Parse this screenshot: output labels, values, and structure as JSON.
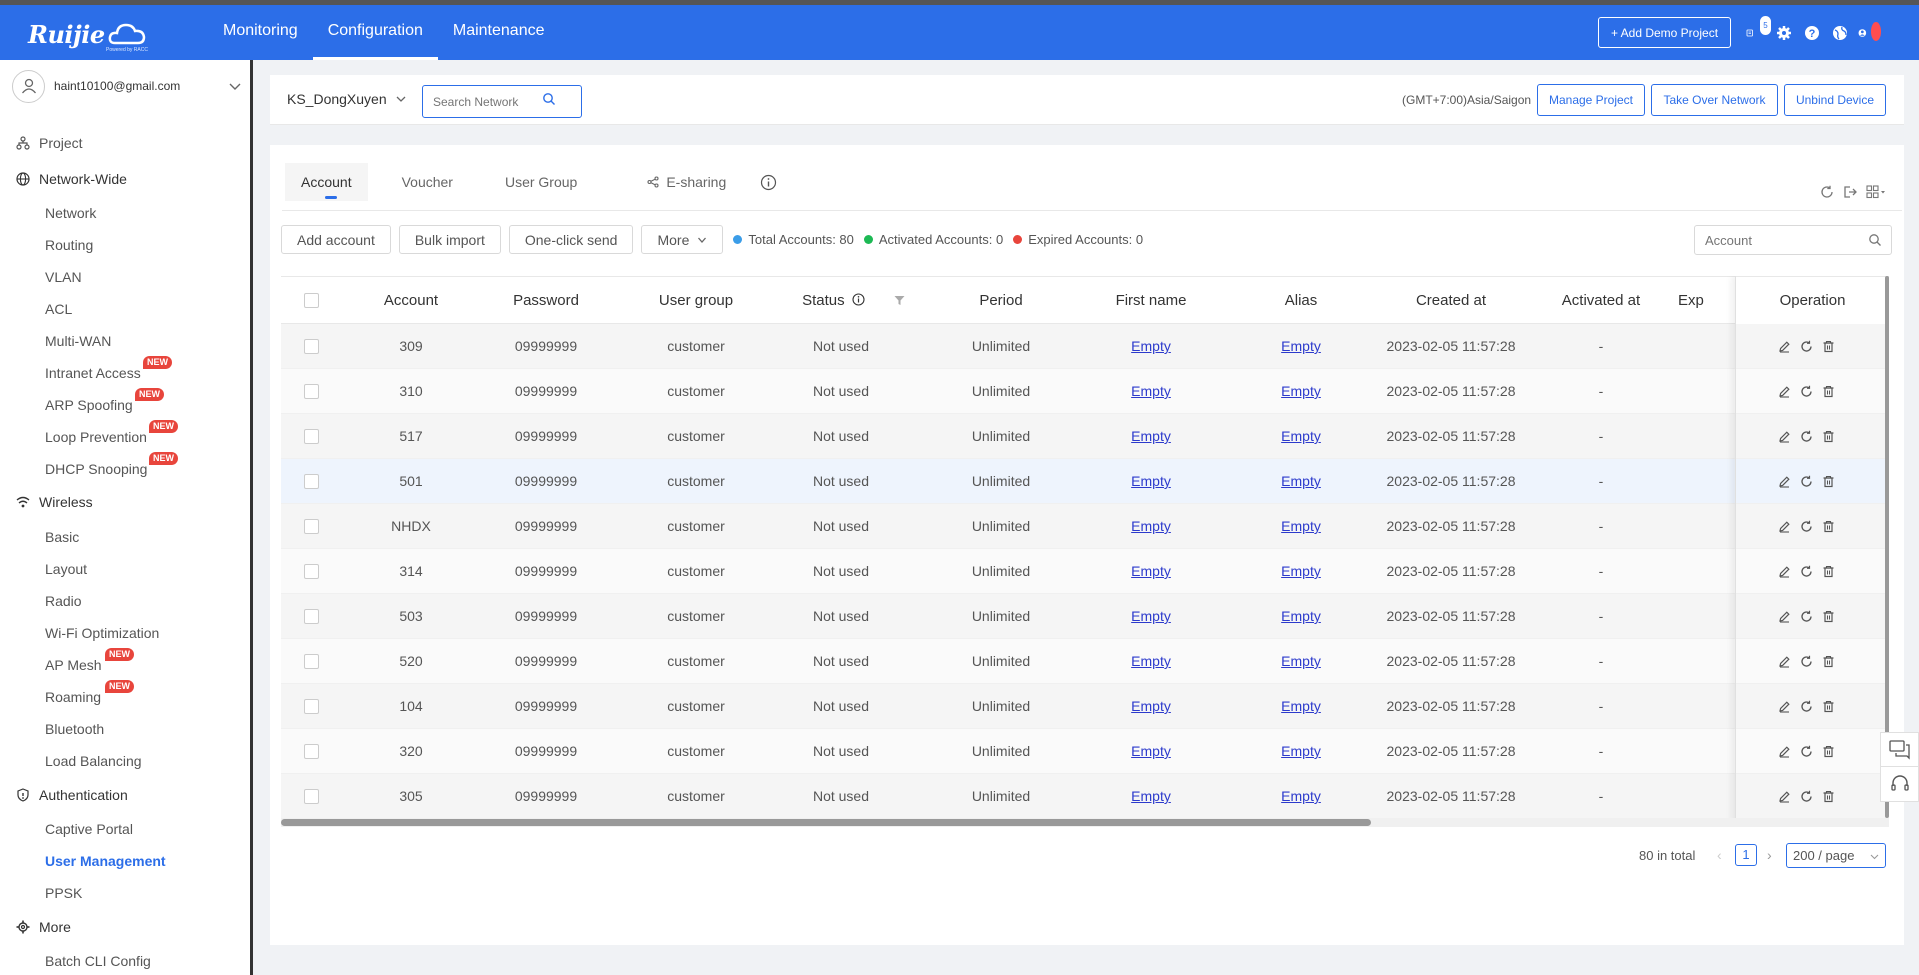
{
  "brand": {
    "logo_text": "Ruijie",
    "logo_sub": "Powered by RACC"
  },
  "topnav": [
    {
      "label": "Monitoring"
    },
    {
      "label": "Configuration"
    },
    {
      "label": "Maintenance"
    }
  ],
  "topbar": {
    "add_demo_label": "+ Add Demo Project",
    "message_count": "5"
  },
  "user": {
    "email": "haint10100@gmail.com"
  },
  "sidebar": {
    "project": "Project",
    "network_wide": "Network-Wide",
    "network_items": [
      "Network",
      "Routing",
      "VLAN",
      "ACL",
      "Multi-WAN",
      "Intranet Access",
      "ARP Spoofing",
      "Loop Prevention",
      "DHCP Snooping"
    ],
    "wireless": "Wireless",
    "wireless_items": [
      "Basic",
      "Layout",
      "Radio",
      "Wi-Fi Optimization",
      "AP Mesh",
      "Roaming",
      "Bluetooth",
      "Load Balancing"
    ],
    "authentication": "Authentication",
    "auth_items": [
      "Captive Portal",
      "User Management",
      "PPSK"
    ],
    "more": "More",
    "more_items": [
      "Batch CLI Config"
    ],
    "new_badge": "NEW"
  },
  "header": {
    "project_name": "KS_DongXuyen",
    "search_placeholder": "Search Network",
    "timezone": "(GMT+7:00)Asia/Saigon",
    "manage_project": "Manage Project",
    "take_over": "Take Over Network",
    "unbind": "Unbind Device"
  },
  "tabs": [
    "Account",
    "Voucher",
    "User Group",
    "E-sharing"
  ],
  "toolbar": {
    "add_account": "Add account",
    "bulk_import": "Bulk import",
    "one_click_send": "One-click send",
    "more": "More",
    "total_accounts": "Total Accounts: 80",
    "activated_accounts": "Activated Accounts: 0",
    "expired_accounts": "Expired Accounts: 0",
    "account_search_placeholder": "Account"
  },
  "colors": {
    "accent": "#2c6ee8",
    "total_dot": "#3b9de8",
    "activated_dot": "#1db954",
    "expired_dot": "#e8453c"
  },
  "table": {
    "columns": [
      "Account",
      "Password",
      "User group",
      "Status",
      "Period",
      "First name",
      "Alias",
      "Created at",
      "Activated at",
      "Exp",
      "Operation"
    ],
    "rows": [
      {
        "account": "309",
        "password": "09999999",
        "group": "customer",
        "status": "Not used",
        "period": "Unlimited",
        "first_name": "Empty",
        "alias": "Empty",
        "created": "2023-02-05 11:57:28",
        "activated": "-"
      },
      {
        "account": "310",
        "password": "09999999",
        "group": "customer",
        "status": "Not used",
        "period": "Unlimited",
        "first_name": "Empty",
        "alias": "Empty",
        "created": "2023-02-05 11:57:28",
        "activated": "-"
      },
      {
        "account": "517",
        "password": "09999999",
        "group": "customer",
        "status": "Not used",
        "period": "Unlimited",
        "first_name": "Empty",
        "alias": "Empty",
        "created": "2023-02-05 11:57:28",
        "activated": "-"
      },
      {
        "account": "501",
        "password": "09999999",
        "group": "customer",
        "status": "Not used",
        "period": "Unlimited",
        "first_name": "Empty",
        "alias": "Empty",
        "created": "2023-02-05 11:57:28",
        "activated": "-"
      },
      {
        "account": "NHDX",
        "password": "09999999",
        "group": "customer",
        "status": "Not used",
        "period": "Unlimited",
        "first_name": "Empty",
        "alias": "Empty",
        "created": "2023-02-05 11:57:28",
        "activated": "-"
      },
      {
        "account": "314",
        "password": "09999999",
        "group": "customer",
        "status": "Not used",
        "period": "Unlimited",
        "first_name": "Empty",
        "alias": "Empty",
        "created": "2023-02-05 11:57:28",
        "activated": "-"
      },
      {
        "account": "503",
        "password": "09999999",
        "group": "customer",
        "status": "Not used",
        "period": "Unlimited",
        "first_name": "Empty",
        "alias": "Empty",
        "created": "2023-02-05 11:57:28",
        "activated": "-"
      },
      {
        "account": "520",
        "password": "09999999",
        "group": "customer",
        "status": "Not used",
        "period": "Unlimited",
        "first_name": "Empty",
        "alias": "Empty",
        "created": "2023-02-05 11:57:28",
        "activated": "-"
      },
      {
        "account": "104",
        "password": "09999999",
        "group": "customer",
        "status": "Not used",
        "period": "Unlimited",
        "first_name": "Empty",
        "alias": "Empty",
        "created": "2023-02-05 11:57:28",
        "activated": "-"
      },
      {
        "account": "320",
        "password": "09999999",
        "group": "customer",
        "status": "Not used",
        "period": "Unlimited",
        "first_name": "Empty",
        "alias": "Empty",
        "created": "2023-02-05 11:57:28",
        "activated": "-"
      },
      {
        "account": "305",
        "password": "09999999",
        "group": "customer",
        "status": "Not used",
        "period": "Unlimited",
        "first_name": "Empty",
        "alias": "Empty",
        "created": "2023-02-05 11:57:28",
        "activated": "-"
      }
    ]
  },
  "pagination": {
    "total": "80 in total",
    "page": "1",
    "page_size": "200 / page"
  }
}
